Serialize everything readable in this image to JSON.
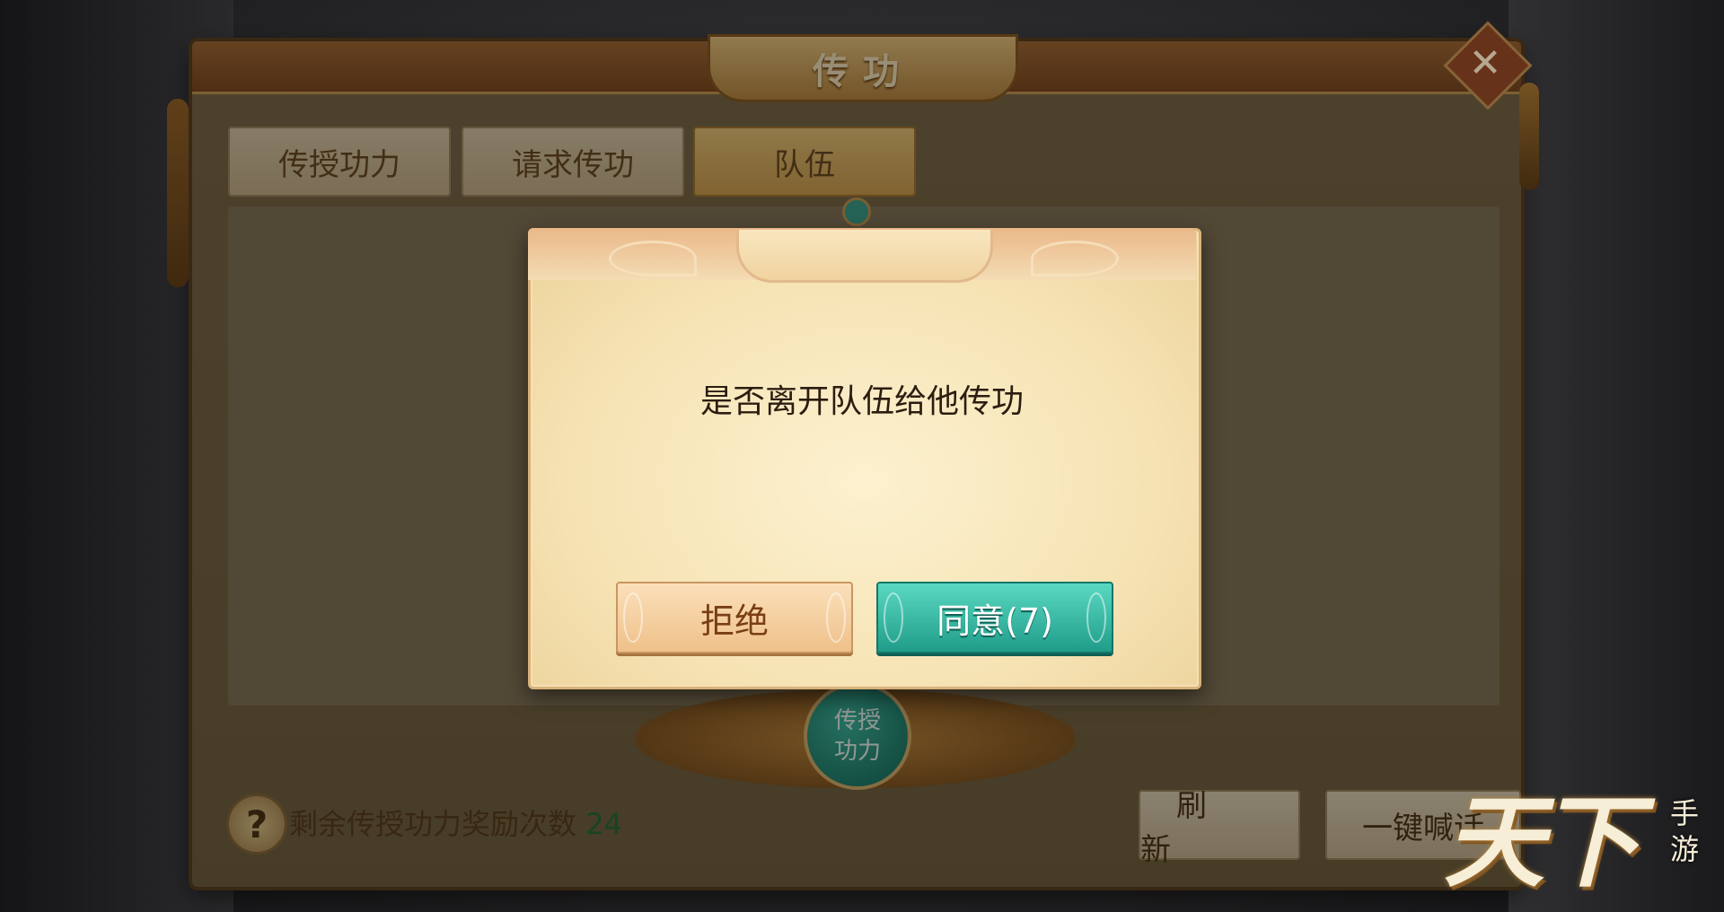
{
  "window": {
    "title": "传功",
    "close_glyph": "✕"
  },
  "tabs": [
    {
      "label": "传授功力",
      "active": false
    },
    {
      "label": "请求传功",
      "active": false
    },
    {
      "label": "队伍",
      "active": true
    }
  ],
  "altar": {
    "button_line1": "传授",
    "button_line2": "功力"
  },
  "footer": {
    "help_glyph": "?",
    "reward_label": "剩余传授功力奖励次数",
    "reward_count": "24",
    "refresh_label": "刷新",
    "shout_label": "一键喊话"
  },
  "dialog": {
    "message": "是否离开队伍给他传功",
    "reject_label": "拒绝",
    "agree_label": "同意(7)"
  },
  "logo": {
    "main": "天下",
    "sub": "手游"
  },
  "colors": {
    "agree_button": "#1f9d8a",
    "reject_button": "#efc08a",
    "dialog_bg": "#f6e3b4"
  }
}
